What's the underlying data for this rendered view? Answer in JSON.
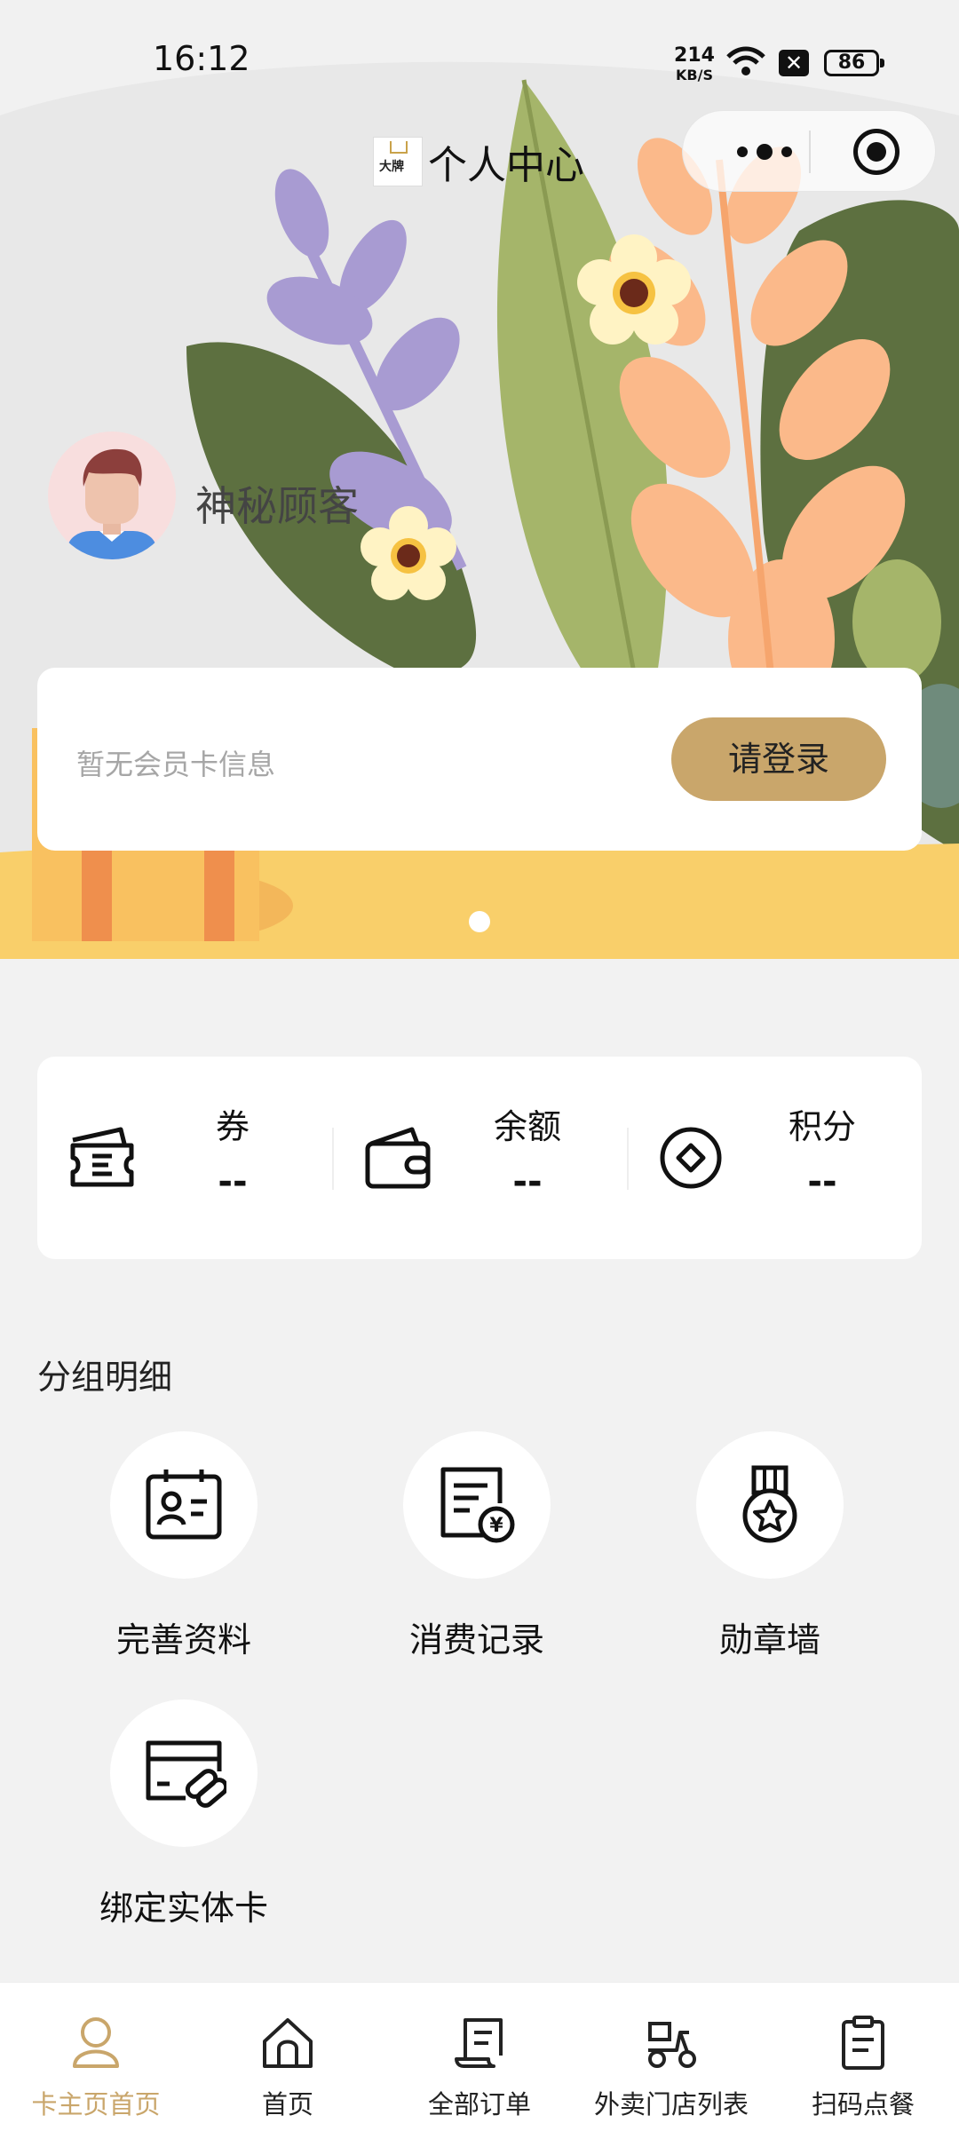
{
  "status_bar": {
    "time": "16:12",
    "speed_value": "214",
    "speed_unit": "KB/S",
    "battery": "86"
  },
  "header": {
    "title": "个人中心",
    "logo_text": "大牌"
  },
  "profile": {
    "nickname": "神秘顾客"
  },
  "member_card": {
    "empty_text": "暂无会员卡信息",
    "login_label": "请登录"
  },
  "carousel": {
    "count": 1,
    "active": 0
  },
  "assets": [
    {
      "label": "券",
      "value": "--",
      "icon": "ticket-icon"
    },
    {
      "label": "余额",
      "value": "--",
      "icon": "wallet-icon"
    },
    {
      "label": "积分",
      "value": "--",
      "icon": "points-icon"
    }
  ],
  "section": {
    "title": "分组明细"
  },
  "grid": [
    {
      "label": "完善资料",
      "icon": "profile-card-icon"
    },
    {
      "label": "消费记录",
      "icon": "receipt-icon"
    },
    {
      "label": "勋章墙",
      "icon": "medal-icon"
    },
    {
      "label": "绑定实体卡",
      "icon": "bind-card-icon"
    }
  ],
  "tabbar": [
    {
      "label": "卡主页首页",
      "icon": "user-icon",
      "active": true
    },
    {
      "label": "首页",
      "icon": "home-icon",
      "active": false
    },
    {
      "label": "全部订单",
      "icon": "order-icon",
      "active": false
    },
    {
      "label": "外卖门店列表",
      "icon": "delivery-icon",
      "active": false
    },
    {
      "label": "扫码点餐",
      "icon": "clipboard-icon",
      "active": false
    }
  ],
  "colors": {
    "accent": "#c9a66b",
    "background": "#f2f2f2",
    "banner_yellow": "#f9cf6a"
  }
}
